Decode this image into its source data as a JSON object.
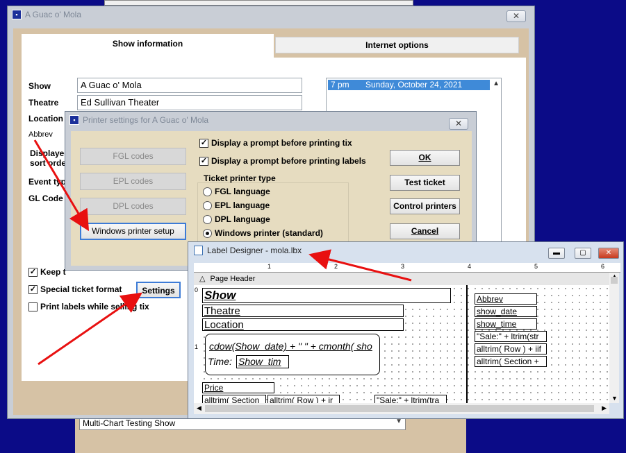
{
  "colors": {
    "desktop": "#0b0b87",
    "accent_arrow": "#e81010",
    "selection": "#3f8ad8"
  },
  "background": {
    "combo_value": "Multi-Chart Testing Show"
  },
  "main_window": {
    "title": "A Guac o' Mola",
    "close_label": "✕",
    "tabs": [
      {
        "label": "Show information"
      },
      {
        "label": "Internet options"
      }
    ],
    "labels": {
      "show": "Show",
      "theatre": "Theatre",
      "location": "Location",
      "abbrev": "Abbrev",
      "displayed_1": "Displayed",
      "displayed_2": "sort order",
      "event_type": "Event type",
      "gl_code": "GL Code"
    },
    "fields": {
      "show": "A Guac o' Mola",
      "theatre": "Ed Sullivan Theater"
    },
    "performances": [
      {
        "time": "7 pm",
        "date": "Sunday, October 24, 2021"
      }
    ],
    "checkboxes": {
      "keep": {
        "label": "Keep t",
        "checked": true
      },
      "special_ticket": {
        "label": "Special ticket format",
        "checked": true
      },
      "print_labels": {
        "label": "Print labels while selling tix",
        "checked": false
      }
    },
    "settings_button": "Settings"
  },
  "printer_dialog": {
    "title": "Printer settings for A Guac o' Mola",
    "close_label": "✕",
    "code_buttons": [
      "FGL codes",
      "EPL codes",
      "DPL codes"
    ],
    "windows_setup_button": "Windows printer setup",
    "check_prompt_tix": "Display a prompt before printing tix",
    "check_prompt_labels": "Display a prompt before printing labels",
    "printer_type_label": "Ticket printer type",
    "radios": [
      {
        "label": "FGL language",
        "selected": false
      },
      {
        "label": "EPL language",
        "selected": false
      },
      {
        "label": "DPL language",
        "selected": false
      },
      {
        "label": "Windows printer (standard)",
        "selected": true
      }
    ],
    "buttons": {
      "ok": "OK",
      "test": "Test ticket",
      "control": "Control printers",
      "cancel": "Cancel"
    }
  },
  "label_designer": {
    "title": "Label Designer - mola.lbx",
    "band": "Page Header",
    "ruler_numbers": [
      "1",
      "2",
      "3",
      "4",
      "5",
      "6"
    ],
    "vruler_numbers": [
      "0",
      "1"
    ],
    "fields": {
      "show": "Show",
      "theatre": "Theatre",
      "location": "Location",
      "date_expr": "cdow(Show_date) + \" \" + cmonth( sho",
      "time_prefix": "Time:",
      "time_field": "Show_tim",
      "price": "Price",
      "bottom_1": "alltrim( Section",
      "bottom_2": "alltrim( Row ) + ir",
      "bottom_3": "\"Sale:\" + ltrim(tra",
      "right_abbrev": "Abbrev",
      "right_date": "show_date",
      "right_time": "show_time",
      "right_sale": "\"Sale:\" + ltrim(str",
      "right_row": "alltrim( Row ) + iif",
      "right_section": "alltrim( Section +"
    }
  }
}
